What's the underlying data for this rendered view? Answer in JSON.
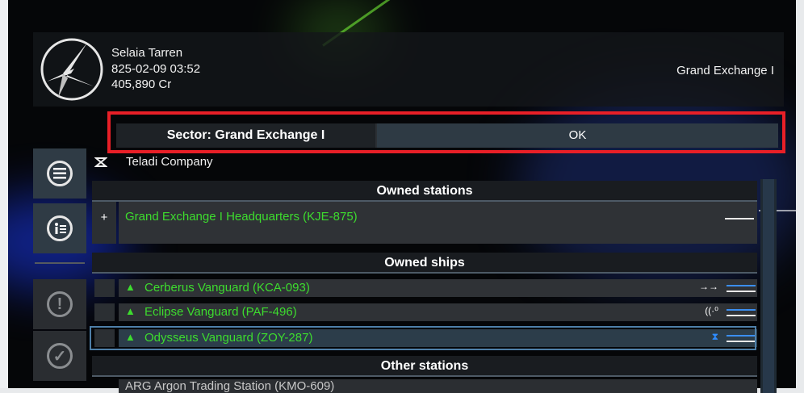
{
  "player": {
    "name": "Selaia Tarren",
    "datetime": "825-02-09 03:52",
    "credits": "405,890 Cr"
  },
  "sector_name": "Grand Exchange I",
  "dialog": {
    "title": "Sector: Grand Exchange I",
    "ok_label": "OK"
  },
  "faction": "Teladi Company",
  "sections": {
    "owned_stations": "Owned stations",
    "owned_ships": "Owned ships",
    "other_stations": "Other stations"
  },
  "stations": [
    {
      "expand": "+",
      "name": "Grand Exchange I Headquarters (KJE-875)"
    }
  ],
  "ships": [
    {
      "name": "Cerberus Vanguard (KCA-093)",
      "status": "→→",
      "status_icon": "move-icon"
    },
    {
      "name": "Eclipse Vanguard (PAF-496)",
      "status": "((·⁰",
      "status_icon": "signal-icon"
    },
    {
      "name": "Odysseus Vanguard (ZOY-287)",
      "status": "⧗",
      "status_icon": "hourglass-icon"
    }
  ],
  "other": [
    {
      "name": "ARG Argon Trading Station (KMO-609)"
    }
  ],
  "colors": {
    "owned": "#3ddc2e",
    "highlight": "#e81f27",
    "accent": "#3b8ef0"
  }
}
